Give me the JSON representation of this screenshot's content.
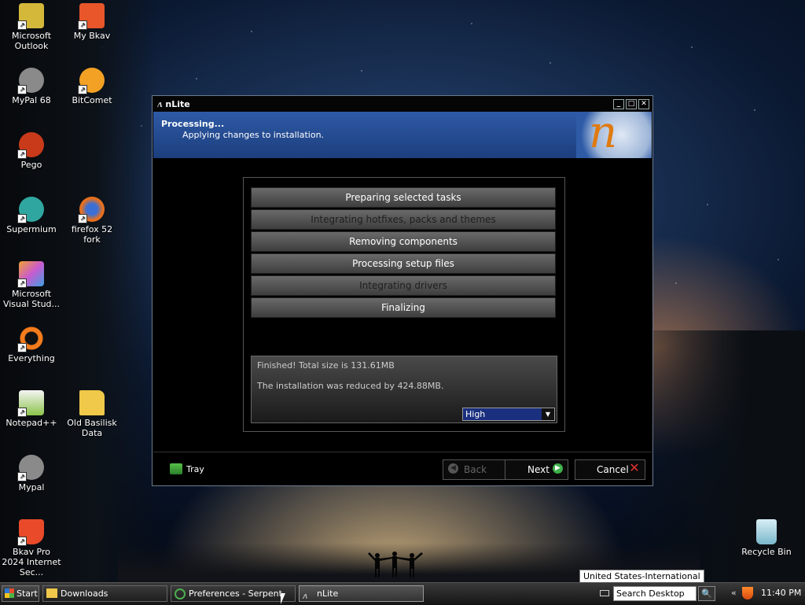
{
  "desktop": {
    "icons": [
      {
        "label": "Microsoft Outlook",
        "icon": "outlook-icon",
        "color": "#d4b83a"
      },
      {
        "label": "My Bkav",
        "icon": "mybkav-icon",
        "color": "#e8562a"
      },
      {
        "label": "MyPal 68",
        "icon": "mypal-icon",
        "color": "#8a8a8a"
      },
      {
        "label": "BitComet",
        "icon": "bitcomet-icon",
        "color": "#f2a124"
      },
      {
        "label": "Pego",
        "icon": "pego-icon",
        "color": "#c83a1a"
      },
      {
        "label": "Supermium",
        "icon": "supermium-icon",
        "color": "#2fa7a0"
      },
      {
        "label": "firefox 52 fork",
        "icon": "firefox-icon",
        "color": "#e6701f"
      },
      {
        "label": "Microsoft Visual Stud...",
        "icon": "visual-studio-icon",
        "color": "#c95bd1"
      },
      {
        "label": "Everything",
        "icon": "everything-icon",
        "color": "#f57c1c"
      },
      {
        "label": "Notepad++",
        "icon": "notepadpp-icon",
        "color": "#8bc34a"
      },
      {
        "label": "Old Basilisk Data",
        "icon": "folder-icon",
        "color": "#f0c84a"
      },
      {
        "label": "Mypal",
        "icon": "mypal-icon",
        "color": "#8a8a8a"
      },
      {
        "label": "Bkav Pro 2024 Internet Sec...",
        "icon": "bkav-pro-icon",
        "color": "#e84a2a"
      },
      {
        "label": "Recycle Bin",
        "icon": "recycle-bin-icon",
        "color": "#9ad0e0"
      }
    ]
  },
  "window": {
    "title": "nLite",
    "logo_glyph": "ʌ",
    "controls": {
      "minimize": "_",
      "maximize": "□",
      "close": "✕"
    },
    "header": {
      "title": "Processing...",
      "subtitle": "Applying changes to installation.",
      "logo_glyph": "n"
    },
    "tasks": [
      {
        "label": "Preparing selected tasks",
        "state": "done"
      },
      {
        "label": "Integrating hotfixes, packs and themes",
        "state": "skipped"
      },
      {
        "label": "Removing components",
        "state": "done"
      },
      {
        "label": "Processing setup files",
        "state": "done"
      },
      {
        "label": "Integrating drivers",
        "state": "skipped"
      },
      {
        "label": "Finalizing",
        "state": "done"
      }
    ],
    "result": {
      "line1": "Finished! Total size is 131.61MB",
      "line2": "The installation was reduced by 424.88MB."
    },
    "priority": {
      "value": "High",
      "arrow": "▼"
    },
    "footer": {
      "tray": "Tray",
      "back": "Back",
      "next": "Next",
      "cancel": "Cancel",
      "back_icon": "◀",
      "next_icon": "▶",
      "cancel_icon": "✕"
    }
  },
  "taskbar": {
    "start": "Start",
    "items": [
      {
        "label": "Downloads",
        "icon": "folder-icon"
      },
      {
        "label": "Preferences - Serpent",
        "icon": "serpent-icon"
      },
      {
        "label": "nLite",
        "icon": "nlite-icon",
        "active": true
      }
    ],
    "search_placeholder": "Search Desktop",
    "search_icon": "🔍",
    "chevron": "«",
    "clock": "11:40 PM",
    "tooltip": "United States-International"
  }
}
